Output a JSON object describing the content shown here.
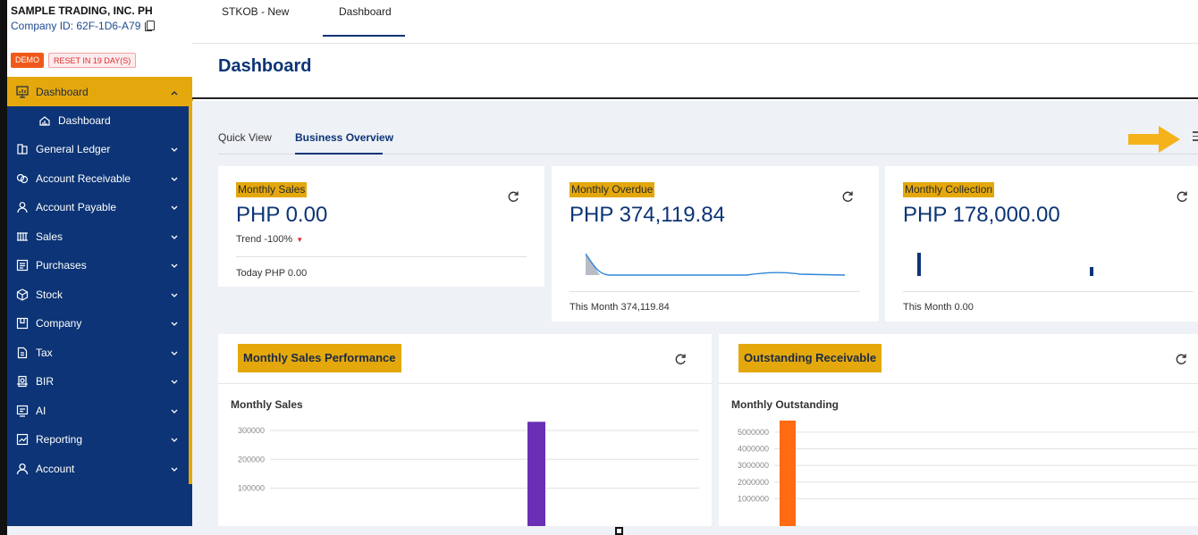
{
  "company": {
    "name": "SAMPLE TRADING, INC. PH",
    "id_text": "Company ID: 62F-1D6-A79"
  },
  "badges": {
    "demo": "DEMO",
    "reset": "RESET IN 19 DAY(S)"
  },
  "sidebar": {
    "items": [
      {
        "label": "Dashboard",
        "icon": "monitor-chart-icon",
        "active": true
      },
      {
        "label": "Dashboard",
        "icon": "dashboard-gauge-icon",
        "sub": true
      },
      {
        "label": "General Ledger",
        "icon": "ledger-icon"
      },
      {
        "label": "Account Receivable",
        "icon": "receivable-icon"
      },
      {
        "label": "Account Payable",
        "icon": "payable-icon"
      },
      {
        "label": "Sales",
        "icon": "sales-icon"
      },
      {
        "label": "Purchases",
        "icon": "purchases-icon"
      },
      {
        "label": "Stock",
        "icon": "cube-icon"
      },
      {
        "label": "Company",
        "icon": "company-icon"
      },
      {
        "label": "Tax",
        "icon": "tax-icon"
      },
      {
        "label": "BIR",
        "icon": "bir-icon"
      },
      {
        "label": "AI",
        "icon": "ai-icon"
      },
      {
        "label": "Reporting",
        "icon": "reporting-icon"
      },
      {
        "label": "Account",
        "icon": "user-icon"
      }
    ]
  },
  "tabs": [
    {
      "label": "STKOB - New"
    },
    {
      "label": "Dashboard",
      "active": true
    }
  ],
  "page": {
    "title": "Dashboard"
  },
  "subtabs": [
    {
      "label": "Quick View"
    },
    {
      "label": "Business Overview",
      "active": true
    }
  ],
  "stats": {
    "sales": {
      "label": "Monthly Sales",
      "value": "PHP 0.00",
      "trend": "Trend -100%",
      "foot": "Today PHP 0.00"
    },
    "overdue": {
      "label": "Monthly Overdue",
      "value": "PHP 374,119.84",
      "foot": "This Month 374,119.84"
    },
    "collection": {
      "label": "Monthly Collection",
      "value": "PHP 178,000.00",
      "foot": "This Month 0.00"
    }
  },
  "panels": {
    "sales_performance": {
      "title": "Monthly Sales Performance",
      "subtitle": "Monthly Sales"
    },
    "outstanding": {
      "title": "Outstanding Receivable",
      "subtitle": "Monthly Outstanding"
    }
  },
  "chart_data": [
    {
      "type": "bar",
      "ylim": [
        0,
        340000
      ],
      "yticks": [
        "300000",
        "200000",
        "100000"
      ],
      "series": [
        {
          "values": [
            330000
          ],
          "color": "#6a2fb5"
        }
      ]
    },
    {
      "type": "bar",
      "ylim": [
        0,
        5800000
      ],
      "yticks": [
        "5000000",
        "4000000",
        "3000000",
        "2000000",
        "1000000"
      ],
      "series": [
        {
          "values": [
            5700000
          ],
          "color": "#ff6a13"
        }
      ]
    }
  ],
  "colors": {
    "sidebar": "#0c3476",
    "accent": "#e4a80d",
    "arrow": "#f5b21a"
  }
}
